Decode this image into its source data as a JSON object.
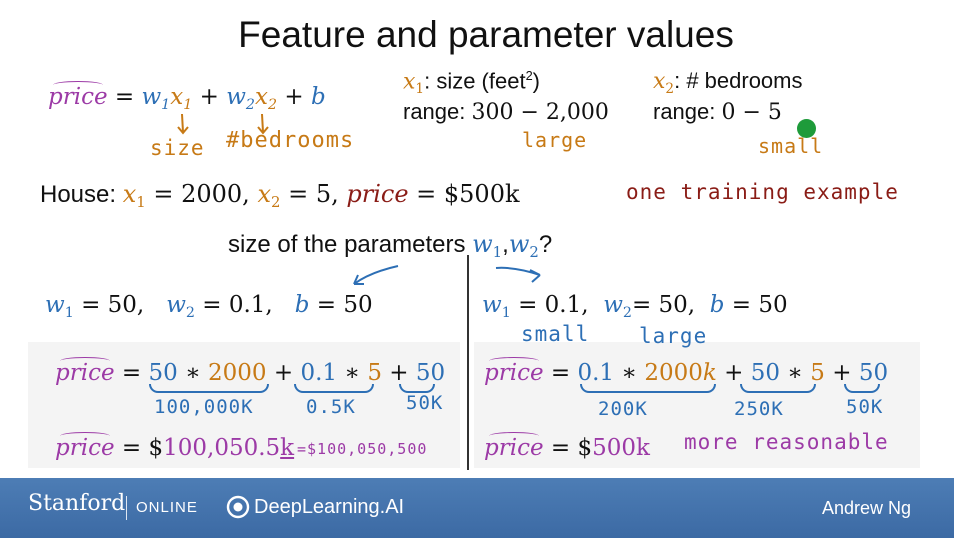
{
  "title": "Feature and parameter values",
  "model": {
    "price": "price",
    "w1": "w",
    "x1": "x",
    "w2": "w",
    "x2": "x",
    "b": "b",
    "sub1": "1",
    "sub2": "2",
    "eq": "=",
    "plus": "+",
    "size_annot": "size",
    "bedrooms_annot": "#bedrooms"
  },
  "feature1": {
    "var": "x",
    "sub": "1",
    "desc_pre": ": size (feet",
    "desc_sup": "2",
    "desc_post": ")",
    "range_label": "range: ",
    "range_value": "300 − 2,000",
    "note": "large"
  },
  "feature2": {
    "var": "x",
    "sub": "2",
    "desc": ":  # bedrooms",
    "range_label": "range: ",
    "range_value": "0 − 5",
    "note": "small"
  },
  "house": {
    "label": "House: ",
    "x1": "x",
    "x1_sub": "1",
    "x1_val": " = 2000, ",
    "x2": "x",
    "x2_sub": "2",
    "x2_val": " = 5, ",
    "price": "price",
    "price_val": " = $500k",
    "note": "one training example"
  },
  "question": {
    "text": "size of the parameters ",
    "w1": "w",
    "w1_sub": "1",
    "comma": ",",
    "w2": "w",
    "w2_sub": "2",
    "qmark": "?"
  },
  "left": {
    "w1": "w",
    "w1_sub": "1",
    "w1_val": " = 50,",
    "w2": "w",
    "w2_sub": "2",
    "w2_val": " = 0.1,",
    "b": "b",
    "b_val": " = 50",
    "calc_price": "price",
    "calc_eq": " = ",
    "t1a": "50",
    "t1op": " ∗ ",
    "t1b": "2000",
    "plus1": " + ",
    "t2a": "0.1",
    "t2op": " ∗ ",
    "t2b": "5",
    "plus2": " + ",
    "t3": "50",
    "ann1": "100,000K",
    "ann2": "0.5K",
    "ann3": "50K",
    "res_price": "price",
    "res_eq": " = $",
    "res_val": "100,050.5",
    "res_k": "k",
    "res_note": "=$100,050,500"
  },
  "right": {
    "w1": "w",
    "w1_sub": "1",
    "w1_val": " = 0.1,",
    "w2": "w",
    "w2_sub": "2",
    "w2_val": "= 50,",
    "b": "b",
    "b_val": " = 50",
    "small": "small",
    "large": "large",
    "calc_price": "price",
    "calc_eq": " = ",
    "t1a": "0.1",
    "t1op": " ∗ ",
    "t1b": "2000",
    "t1k": "k",
    "plus1": " + ",
    "t2a": "50",
    "t2op": " ∗ ",
    "t2b": "5",
    "plus2": " + ",
    "t3": "50",
    "ann1": "200K",
    "ann2": "250K",
    "ann3": "50K",
    "res_price": "price",
    "res_eq": " = $",
    "res_val": "500k",
    "res_note": "more   reasonable"
  },
  "footer": {
    "stanford": "Stanford",
    "online": "ONLINE",
    "dl": "DeepLearning.AI",
    "author": "Andrew Ng"
  },
  "colors": {
    "purple": "#9c3aa6",
    "blue": "#2d6fb5",
    "orange": "#c77a16",
    "dark_red": "#8a1c16",
    "footer_bg": "#4477b0",
    "cursor_dot": "#1e9b3a"
  }
}
